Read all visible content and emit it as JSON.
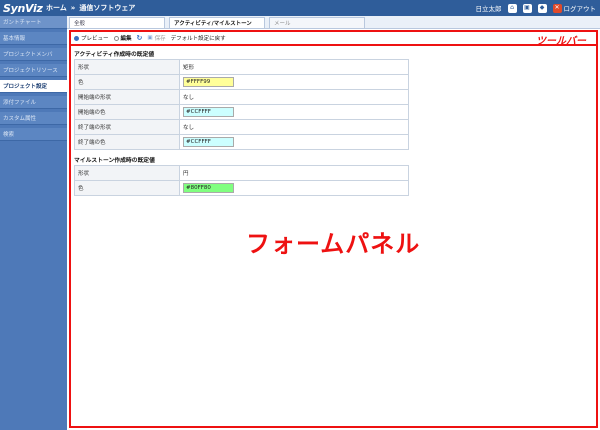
{
  "header": {
    "logo": "SynViz",
    "breadcrumb_home": "ホーム",
    "breadcrumb_sep": "»",
    "breadcrumb_project": "通信ソフトウェア",
    "user": "日立太郎",
    "logout": "ログアウト"
  },
  "sidebar": {
    "items": [
      {
        "label": "ガントチャート"
      },
      {
        "label": "基本情報"
      },
      {
        "label": "プロジェクトメンバ"
      },
      {
        "label": "プロジェクトリソース"
      },
      {
        "label": "プロジェクト設定"
      },
      {
        "label": "添付ファイル"
      },
      {
        "label": "カスタム属性"
      },
      {
        "label": "検索"
      }
    ]
  },
  "tabs": [
    {
      "label": "全般"
    },
    {
      "label": "アクティビティ/マイルストーン"
    },
    {
      "label": "メール"
    }
  ],
  "toolbar": {
    "preview": "プレビュー",
    "edit": "編集",
    "save": "保存",
    "reset": "デフォルト設定に戻す",
    "annotation": "ツールバー"
  },
  "activity": {
    "title": "アクティビティ作成時の既定値",
    "rows": [
      {
        "label": "形状",
        "value": "矩形"
      },
      {
        "label": "色",
        "value": "#FFFF99",
        "color": "#FFFF99"
      },
      {
        "label": "開始端の形状",
        "value": "なし"
      },
      {
        "label": "開始端の色",
        "value": "#CCFFFF",
        "color": "#CCFFFF"
      },
      {
        "label": "終了端の形状",
        "value": "なし"
      },
      {
        "label": "終了端の色",
        "value": "#CCFFFF",
        "color": "#CCFFFF"
      }
    ]
  },
  "milestone": {
    "title": "マイルストーン作成時の既定値",
    "rows": [
      {
        "label": "形状",
        "value": "円"
      },
      {
        "label": "色",
        "value": "#80FF80",
        "color": "#80FF80"
      }
    ]
  },
  "panel_annotation": "フォームパネル"
}
